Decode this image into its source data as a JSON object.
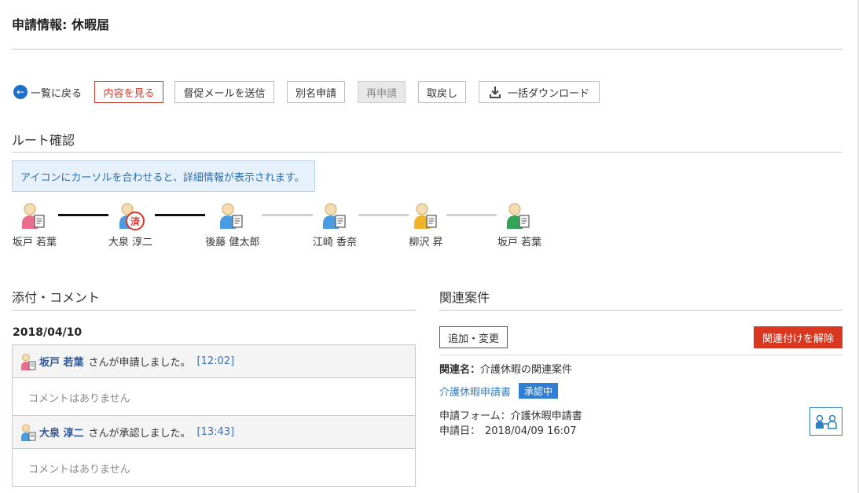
{
  "page": {
    "title": "申請情報: 休暇届"
  },
  "toolbar": {
    "back_label": "一覧に戻る",
    "view_content": "内容を見る",
    "send_reminder": "督促メールを送信",
    "alias_apply": "別名申請",
    "reapply": "再申請",
    "withdraw": "取戻し",
    "bulk_download": "一括ダウンロード"
  },
  "route": {
    "title": "ルート確認",
    "hint": "アイコンにカーソルを合わせると、詳細情報が表示されます。",
    "stamp_label": "済",
    "steps": [
      {
        "name": "坂戸 若葉",
        "color": "#ec6d8e"
      },
      {
        "name": "大泉 淳二",
        "color": "#4a9be0"
      },
      {
        "name": "後藤 健太郎",
        "color": "#4a9be0"
      },
      {
        "name": "江崎 香奈",
        "color": "#4a9be0"
      },
      {
        "name": "柳沢 昇",
        "color": "#f0b429"
      },
      {
        "name": "坂戸 若葉",
        "color": "#31a457"
      }
    ]
  },
  "attachments": {
    "title": "添付・コメント",
    "date": "2018/04/10",
    "entries": [
      {
        "user": "坂戸 若葉",
        "action": "さんが申請しました。",
        "time": "[12:02]",
        "comment": "コメントはありません"
      },
      {
        "user": "大泉 淳二",
        "action": "さんが承認しました。",
        "time": "[13:43]",
        "comment": "コメントはありません"
      }
    ]
  },
  "related": {
    "title": "関連案件",
    "add_change": "追加・変更",
    "unlink": "関連付けを解除",
    "name_label": "関連名：",
    "name_value": "介護休暇の関連案件",
    "item_link": "介護休暇申請書",
    "item_status": "承認中",
    "form_label": "申請フォーム：",
    "form_value": "介護休暇申請書",
    "date_label": "申請日：",
    "date_value": "2018/04/09 16:07"
  }
}
